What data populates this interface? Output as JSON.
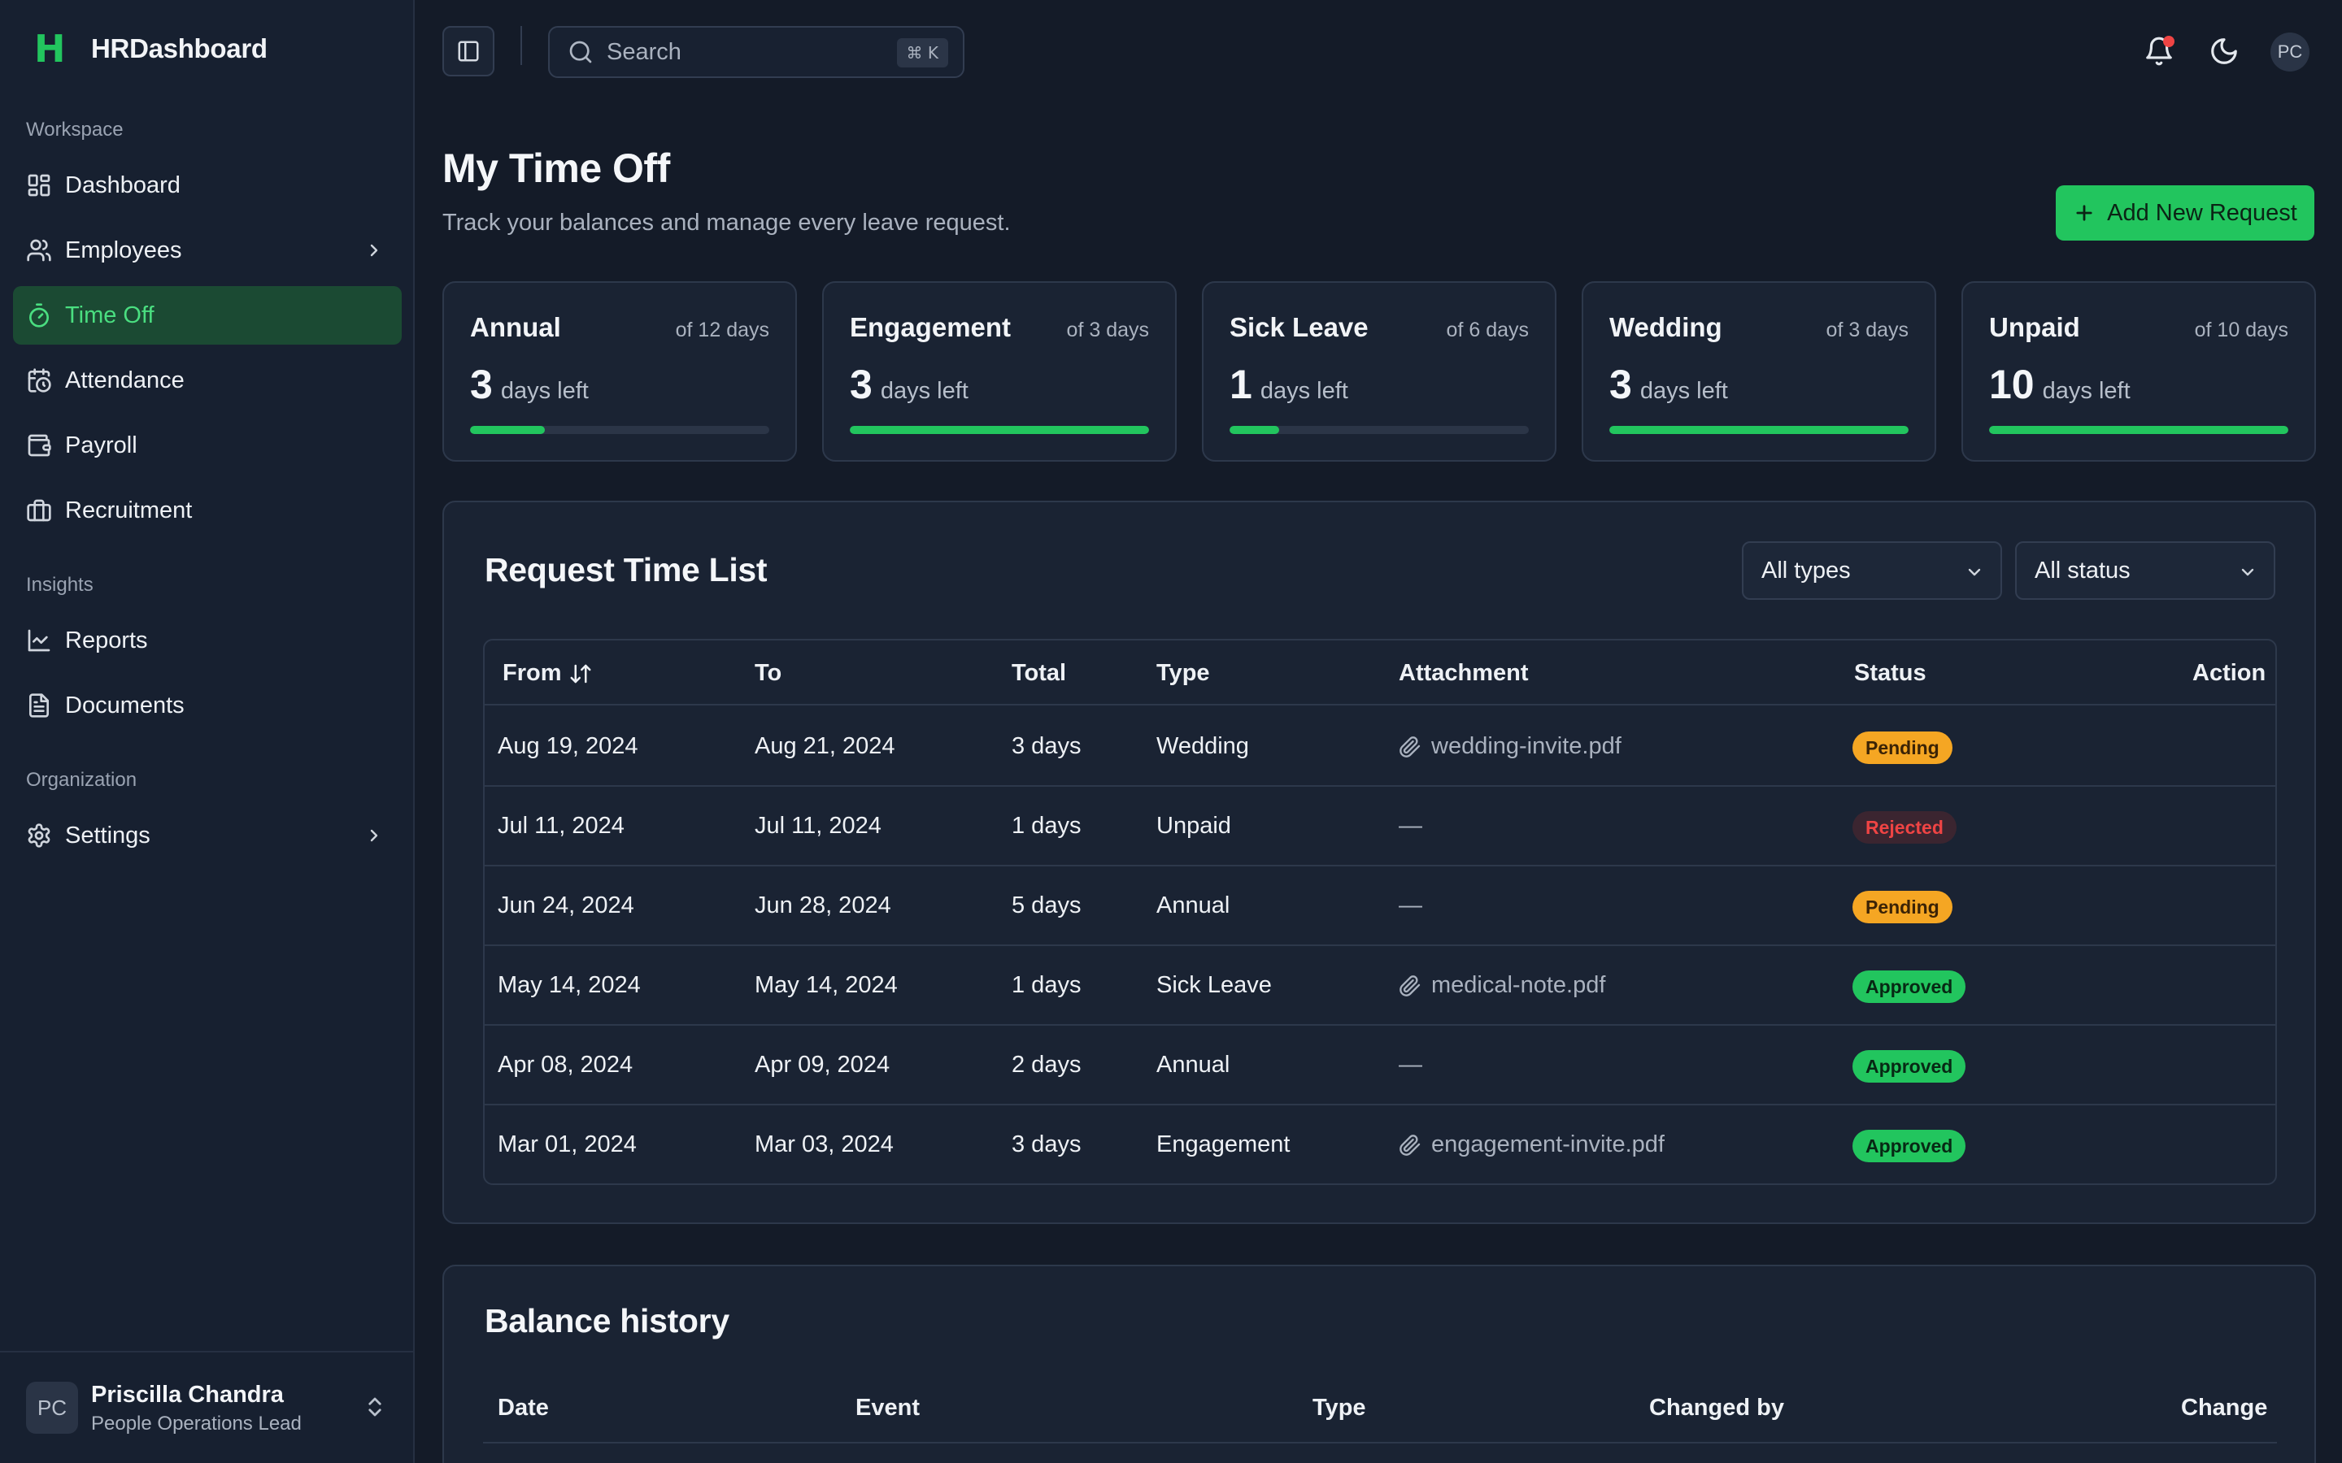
{
  "app": {
    "logo_letter": "H",
    "name": "HRDashboard"
  },
  "sidebar": {
    "sections": [
      "Workspace",
      "Insights",
      "Organization"
    ],
    "items": [
      {
        "label": "Dashboard",
        "icon": "layout-dashboard-icon"
      },
      {
        "label": "Employees",
        "icon": "users-icon",
        "has_submenu": true
      },
      {
        "label": "Time Off",
        "icon": "timer-icon",
        "active": true
      },
      {
        "label": "Attendance",
        "icon": "calendar-clock-icon"
      },
      {
        "label": "Payroll",
        "icon": "wallet-icon"
      },
      {
        "label": "Recruitment",
        "icon": "briefcase-icon"
      },
      {
        "label": "Reports",
        "icon": "line-chart-icon"
      },
      {
        "label": "Documents",
        "icon": "file-text-icon"
      },
      {
        "label": "Settings",
        "icon": "gear-icon",
        "has_submenu": true
      }
    ]
  },
  "user": {
    "initials": "PC",
    "name": "Priscilla Chandra",
    "role": "People Operations Lead"
  },
  "topbar": {
    "search_placeholder": "Search",
    "shortcut": "⌘ K",
    "avatar_initials": "PC",
    "has_notification": true
  },
  "header": {
    "title": "My Time Off",
    "subtitle": "Track your balances and manage every leave request.",
    "add_button": "Add New Request"
  },
  "balances": [
    {
      "type": "Annual",
      "total": "of 12 days",
      "left": "3",
      "unit": "days left",
      "progress": 0.25
    },
    {
      "type": "Engagement",
      "total": "of 3 days",
      "left": "3",
      "unit": "days left",
      "progress": 1.0
    },
    {
      "type": "Sick Leave",
      "total": "of 6 days",
      "left": "1",
      "unit": "days left",
      "progress": 0.167
    },
    {
      "type": "Wedding",
      "total": "of 3 days",
      "left": "3",
      "unit": "days left",
      "progress": 1.0
    },
    {
      "type": "Unpaid",
      "total": "of 10 days",
      "left": "10",
      "unit": "days left",
      "progress": 1.0
    }
  ],
  "requests": {
    "title": "Request Time List",
    "filter_type": "All types",
    "filter_status": "All status",
    "columns": [
      "From",
      "To",
      "Total",
      "Type",
      "Attachment",
      "Status",
      "Action"
    ],
    "rows": [
      {
        "from": "Aug 19, 2024",
        "to": "Aug 21, 2024",
        "total": "3 days",
        "type": "Wedding",
        "attachment": "wedding-invite.pdf",
        "status": "Pending",
        "status_kind": "pending"
      },
      {
        "from": "Jul 11, 2024",
        "to": "Jul 11, 2024",
        "total": "1 days",
        "type": "Unpaid",
        "attachment": "—",
        "status": "Rejected",
        "status_kind": "rejected"
      },
      {
        "from": "Jun 24, 2024",
        "to": "Jun 28, 2024",
        "total": "5 days",
        "type": "Annual",
        "attachment": "—",
        "status": "Pending",
        "status_kind": "pending"
      },
      {
        "from": "May 14, 2024",
        "to": "May 14, 2024",
        "total": "1 days",
        "type": "Sick Leave",
        "attachment": "medical-note.pdf",
        "status": "Approved",
        "status_kind": "approved"
      },
      {
        "from": "Apr 08, 2024",
        "to": "Apr 09, 2024",
        "total": "2 days",
        "type": "Annual",
        "attachment": "—",
        "status": "Approved",
        "status_kind": "approved"
      },
      {
        "from": "Mar 01, 2024",
        "to": "Mar 03, 2024",
        "total": "3 days",
        "type": "Engagement",
        "attachment": "engagement-invite.pdf",
        "status": "Approved",
        "status_kind": "approved"
      }
    ]
  },
  "history": {
    "title": "Balance history",
    "columns": [
      "Date",
      "Event",
      "Type",
      "Changed by",
      "Change"
    ]
  },
  "colors": {
    "accent": "#22c55e",
    "danger": "#ef4444",
    "warning": "#f5a623",
    "background": "#141b28",
    "surface": "#1a2333"
  }
}
